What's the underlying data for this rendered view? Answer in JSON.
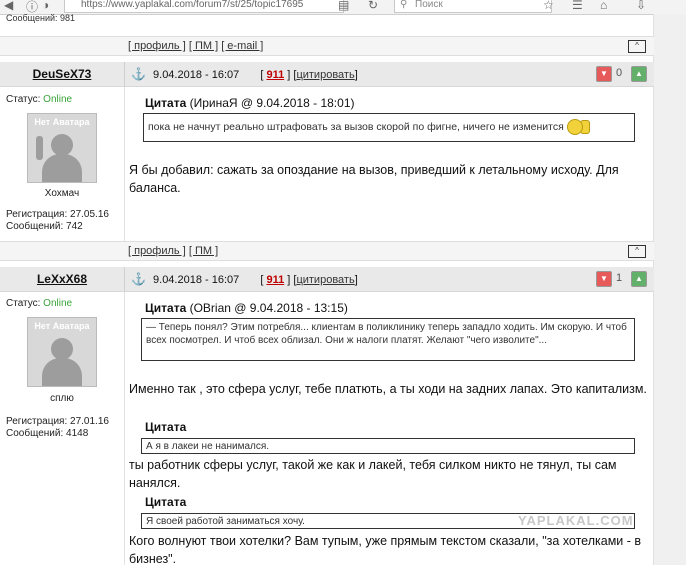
{
  "browser": {
    "url": "https://www.yaplakal.com/forum7/st/25/topic17695",
    "search_placeholder": "Поиск"
  },
  "top_fragment": "Сообщений: 981",
  "post_bar_1": {
    "profile": "[ профиль ]",
    "pm": "[ ПМ ]",
    "email": "[ e-mail ]",
    "up": "[^]"
  },
  "posts": [
    {
      "nick": "DeuSeX73",
      "date": "9.04.2018 - 16:07",
      "number": "911",
      "quote_link": "цитировать",
      "rating": "0",
      "status_label": "Статус:",
      "status_value": "Online",
      "avatar_text": "Нет Аватара",
      "rank": "Хохмач",
      "reg_label": "Регистрация:",
      "reg_value": "27.05.16",
      "msgs_label": "Сообщений:",
      "msgs_value": "742",
      "quote_title": "Цитата",
      "quote_author": "(ИринаЯ @ 9.04.2018 - 18:01)",
      "quote_text": "пока не начнут реально штрафовать за вызов скорой по фигне, ничего не изменится",
      "body": "Я бы добавил: сажать за опоздание на вызов, приведший к летальному исходу. Для баланса."
    },
    {
      "nick": "LeXxX68",
      "date": "9.04.2018 - 16:07",
      "number": "911",
      "quote_link": "цитировать",
      "rating": "1",
      "status_label": "Статус:",
      "status_value": "Online",
      "avatar_text": "Нет Аватара",
      "rank": "сплю",
      "reg_label": "Регистрация:",
      "reg_value": "27.01.16",
      "msgs_label": "Сообщений:",
      "msgs_value": "4148",
      "quote_title": "Цитата",
      "quote_author": "(OBrian @ 9.04.2018 - 13:15)",
      "quote_text": "— Теперь понял? Этим потребля... клиентам в поликлинику теперь западло ходить. Им скорую. И чтоб всех посмотрел. И чтоб всех облизал. Они ж налоги платят. Желают \"чего изволите\"...",
      "body1": "Именно так , это сфера услуг, тебе платють, а ты ходи на задних лапах. Это капитализм.",
      "quote2_title": "Цитата",
      "quote2_text": "А я в лакеи не нанимался.",
      "body2": "ты работник сферы услуг, такой же как и лакей, тебя силком никто не тянул, ты сам нанялся.",
      "quote3_title": "Цитата",
      "quote3_text": "Я своей работой заниматься хочу.",
      "body3": "Кого волнуют твои хотелки? Вам тупым, уже прямым текстом сказали, \"за хотелками - в бизнез\"."
    }
  ],
  "post_bar_2": {
    "profile": "[ профиль ]",
    "pm": "[ ПМ ]",
    "up": "[^]"
  },
  "watermark": "YAPLAKAL.COM",
  "colors": {
    "online": "#39a339",
    "post_number": "#c00000",
    "header_bg": "#e9e9e9"
  }
}
